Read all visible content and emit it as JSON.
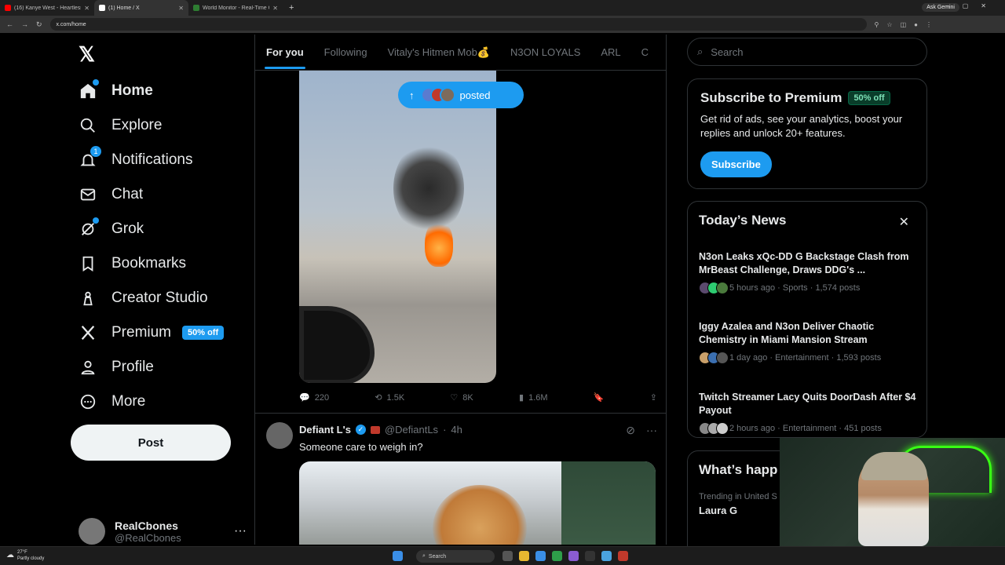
{
  "browser": {
    "tabs": [
      {
        "label": "(16) Kanye West - Heartless - Y",
        "fav_color": "#ff0000",
        "active": false
      },
      {
        "label": "(1) Home / X",
        "fav_color": "#ffffff",
        "active": true
      },
      {
        "label": "World Monitor - Real-Time Glo",
        "fav_color": "#2e7d32",
        "active": false
      }
    ],
    "new_tab": "+",
    "gemini_label": "Ask Gemini",
    "url": "x.com/home"
  },
  "nav": {
    "logo": "𝕏",
    "items": [
      {
        "label": "Home",
        "icon": "home-icon",
        "glyph": "⌂"
      },
      {
        "label": "Explore",
        "icon": "search-icon",
        "glyph": "⌕"
      },
      {
        "label": "Notifications",
        "icon": "bell-icon",
        "glyph": "🔔",
        "badge": "1"
      },
      {
        "label": "Chat",
        "icon": "mail-icon",
        "glyph": "✉"
      },
      {
        "label": "Grok",
        "icon": "grok-icon",
        "glyph": "⊘"
      },
      {
        "label": "Bookmarks",
        "icon": "bookmark-icon",
        "glyph": "🔖"
      },
      {
        "label": "Creator Studio",
        "icon": "creator-icon",
        "glyph": "♙"
      },
      {
        "label": "Premium",
        "icon": "x-icon",
        "glyph": "𝕏",
        "badge_text": "50% off"
      },
      {
        "label": "Profile",
        "icon": "profile-icon",
        "glyph": "👤"
      },
      {
        "label": "More",
        "icon": "more-circle-icon",
        "glyph": "⋯"
      }
    ],
    "post_label": "Post",
    "account": {
      "name": "RealCbones",
      "handle": "@RealCbones",
      "more": "···"
    }
  },
  "feed": {
    "tabs": [
      "For you",
      "Following",
      "Vitaly's Hitmen Mob💰",
      "N3ON LOYALS",
      "ARL",
      "C"
    ],
    "new_posts_pill": {
      "arrow": "↑",
      "label": "posted"
    },
    "actions": {
      "replies": "220",
      "reposts": "1.5K",
      "likes": "8K",
      "views": "1.6M"
    },
    "tweet2": {
      "name": "Defiant L's",
      "handle": "@DefiantLs",
      "time": "4h",
      "text": "Someone care to weigh in?"
    }
  },
  "right": {
    "search_placeholder": "Search",
    "premium": {
      "title": "Subscribe to Premium",
      "badge": "50% off",
      "desc": "Get rid of ads, see your analytics, boost your replies and unlock 20+ features.",
      "button": "Subscribe"
    },
    "news": {
      "title": "Today’s News",
      "items": [
        {
          "title": "N3on Leaks xQc-DD G Backstage Clash from MrBeast Challenge, Draws DDG's ...",
          "meta": "5 hours ago · Sports · 1,574 posts"
        },
        {
          "title": "Iggy Azalea and N3on Deliver Chaotic Chemistry in Miami Mansion Stream",
          "meta": "1 day ago · Entertainment · 1,593 posts"
        },
        {
          "title": "Twitch Streamer Lacy Quits DoorDash After $4 Payout",
          "meta": "2 hours ago · Entertainment · 451 posts"
        }
      ]
    },
    "happening": {
      "title": "What’s happ",
      "trend_label": "Trending in United S",
      "trend": "Laura G"
    }
  },
  "taskbar": {
    "temp": "27°F",
    "weather": "Partly cloudy",
    "search": "Search"
  }
}
